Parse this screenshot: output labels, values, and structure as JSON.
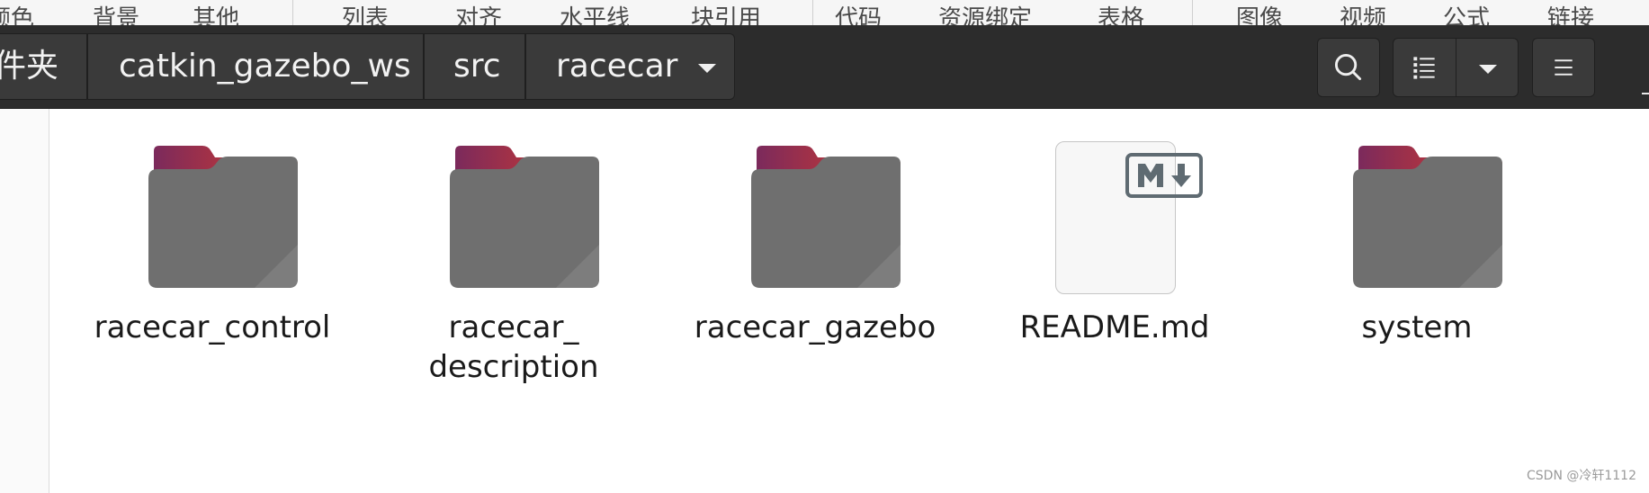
{
  "editor_toolbar": {
    "items": [
      "颜色",
      "背景",
      "其他",
      "列表",
      "对齐",
      "水平线",
      "块引用",
      "代码",
      "资源绑定",
      "表格",
      "图像",
      "视频",
      "公式",
      "链接"
    ]
  },
  "pathbar": {
    "crumbs": [
      "件夹",
      "catkin_gazebo_ws",
      "src",
      "racecar"
    ]
  },
  "toolbar": {
    "search_icon": "search-icon",
    "view_icon": "list-view-icon",
    "view_options_icon": "chevron-down-icon",
    "menu_icon": "hamburger-menu-icon"
  },
  "files": [
    {
      "name": "racecar_control",
      "type": "folder"
    },
    {
      "name": "racecar_description",
      "type": "folder"
    },
    {
      "name": "racecar_gazebo",
      "type": "folder"
    },
    {
      "name": "README.md",
      "type": "markdown"
    },
    {
      "name": "system",
      "type": "folder"
    }
  ],
  "file_labels": {
    "desc_line1": "racecar_",
    "desc_line2": "description"
  },
  "colors": {
    "header_bg": "#2c2c2c",
    "folder_body": "#6f6f6f",
    "folder_tab_start": "#7b2a5c",
    "folder_tab_end": "#e9541c"
  },
  "watermark": "CSDN @冷轩1112"
}
